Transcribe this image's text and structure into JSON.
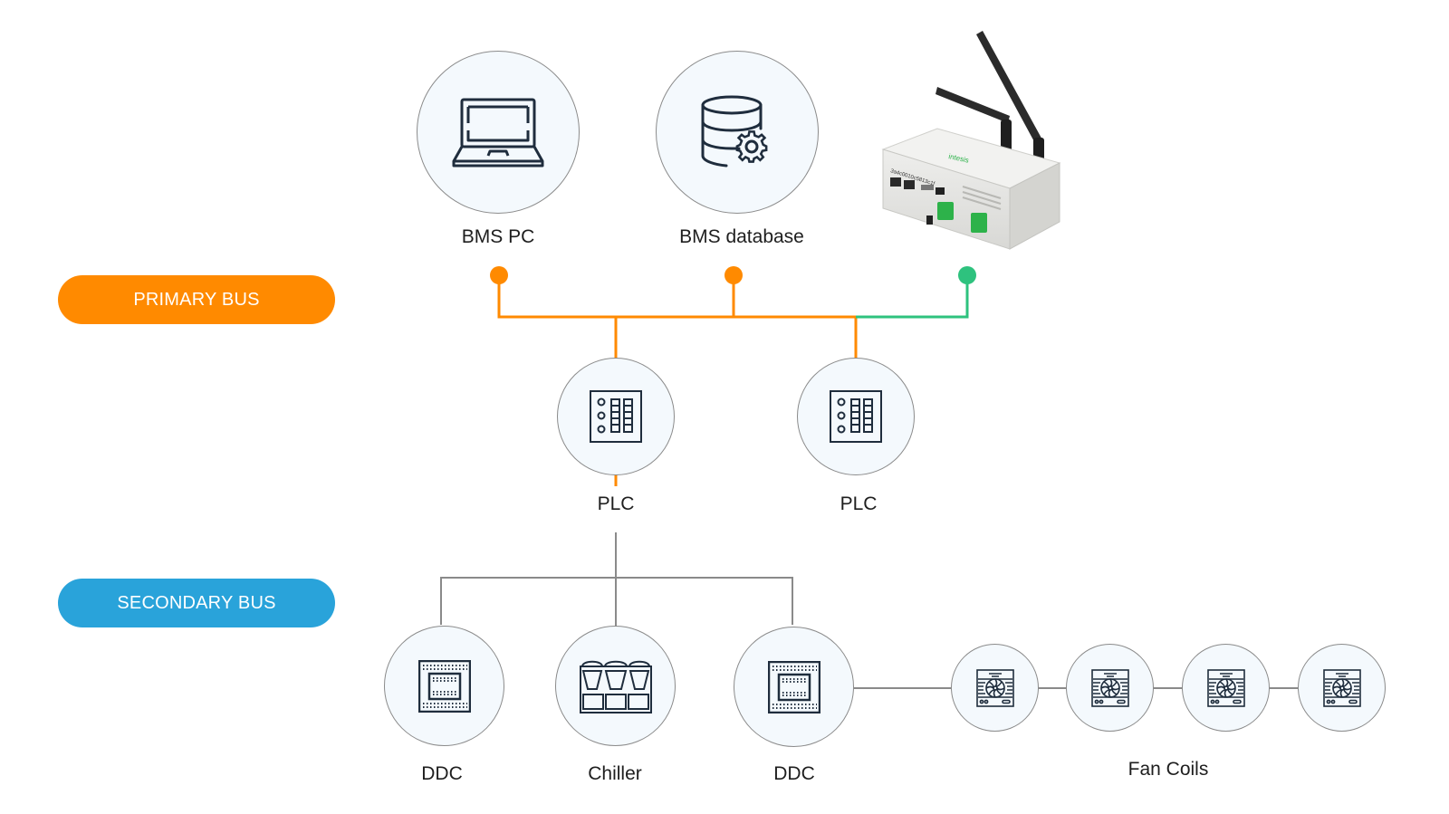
{
  "colors": {
    "primary_bus": "#ff8a00",
    "secondary_bus": "#29a3da",
    "gateway_link": "#2ec27e",
    "secondary_wire": "#8a8a8a",
    "node_fill": "#f4f9fd",
    "icon_stroke": "#1f2d3d"
  },
  "legend": {
    "primary_bus": "PRIMARY BUS",
    "secondary_bus": "SECONDARY BUS"
  },
  "nodes": {
    "bms_pc": {
      "label": "BMS PC",
      "icon": "laptop-icon"
    },
    "bms_database": {
      "label": "BMS database",
      "icon": "database-gear-icon"
    },
    "gateway": {
      "label": "",
      "icon": "iot-gateway-device"
    },
    "plc_1": {
      "label": "PLC",
      "icon": "plc-panel-icon"
    },
    "plc_2": {
      "label": "PLC",
      "icon": "plc-panel-icon"
    },
    "ddc_1": {
      "label": "DDC",
      "icon": "chip-icon"
    },
    "chiller": {
      "label": "Chiller",
      "icon": "chiller-icon"
    },
    "ddc_2": {
      "label": "DDC",
      "icon": "chip-icon"
    },
    "fan_coils": {
      "label": "Fan Coils",
      "count": 4,
      "icon": "fan-coil-icon"
    }
  },
  "gateway_device": {
    "brand_text": "intesis",
    "serial_text": "3a4c0010c5813c1f"
  }
}
